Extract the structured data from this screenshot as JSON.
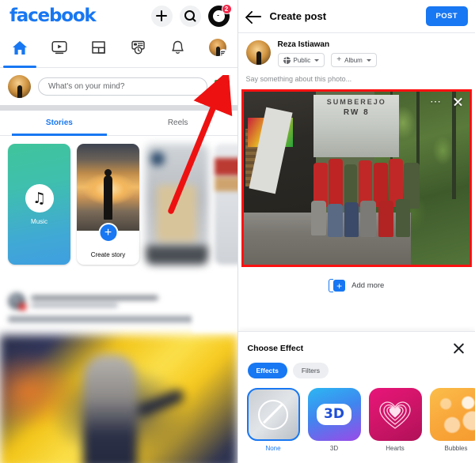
{
  "left": {
    "brand": "facebook",
    "topbar": {
      "add_icon": "plus-icon",
      "search_icon": "search-icon",
      "messenger_icon": "messenger-icon",
      "messenger_badge": "2"
    },
    "nav": [
      {
        "name": "home",
        "icon": "home-icon",
        "active": true
      },
      {
        "name": "watch",
        "icon": "video-icon",
        "active": false
      },
      {
        "name": "marketplace",
        "icon": "marketplace-icon",
        "active": false
      },
      {
        "name": "memories",
        "icon": "memories-icon",
        "active": false
      },
      {
        "name": "notifications",
        "icon": "bell-icon",
        "active": false
      },
      {
        "name": "profile",
        "icon": "avatar-menu-icon",
        "active": false
      }
    ],
    "composer": {
      "placeholder": "What's on your mind?",
      "photo_icon": "photo-library-icon"
    },
    "tabs": [
      {
        "label": "Stories",
        "active": true
      },
      {
        "label": "Reels",
        "active": false
      }
    ],
    "stories": [
      {
        "label": "Music",
        "type": "music"
      },
      {
        "label": "Create story",
        "type": "create"
      }
    ]
  },
  "right": {
    "header": {
      "back_icon": "back-arrow-icon",
      "title": "Create post",
      "post_label": "POST"
    },
    "user": {
      "name": "Reza Istiawan",
      "audience": "Public",
      "audience_icon": "globe-icon",
      "album": "Album",
      "album_icon": "plus-icon"
    },
    "caption_placeholder": "Say something about this photo...",
    "photo": {
      "banner_line1": "SUMBEREJO",
      "banner_line2": "RW 8",
      "menu_icon": "more-options-icon",
      "close_icon": "close-icon",
      "highlight_color": "#ff1111"
    },
    "add_more": {
      "label": "Add more",
      "icon": "add-photo-icon"
    },
    "effect_sheet": {
      "title": "Choose Effect",
      "close_icon": "close-icon",
      "tabs": [
        {
          "label": "Effects",
          "active": true
        },
        {
          "label": "Filters",
          "active": false
        }
      ],
      "effects": [
        {
          "label": "None",
          "selected": true
        },
        {
          "label": "3D",
          "selected": false,
          "badge": "3D"
        },
        {
          "label": "Hearts",
          "selected": false
        },
        {
          "label": "Bubbles",
          "selected": false
        }
      ]
    }
  },
  "annotation": {
    "arrow_color": "#ee1111",
    "arrow_target": "photo-library-icon"
  },
  "colors": {
    "brand_blue": "#1877f2",
    "badge_red": "#f02849",
    "highlight_red": "#ff1111",
    "green_photo": "#20a74a"
  }
}
